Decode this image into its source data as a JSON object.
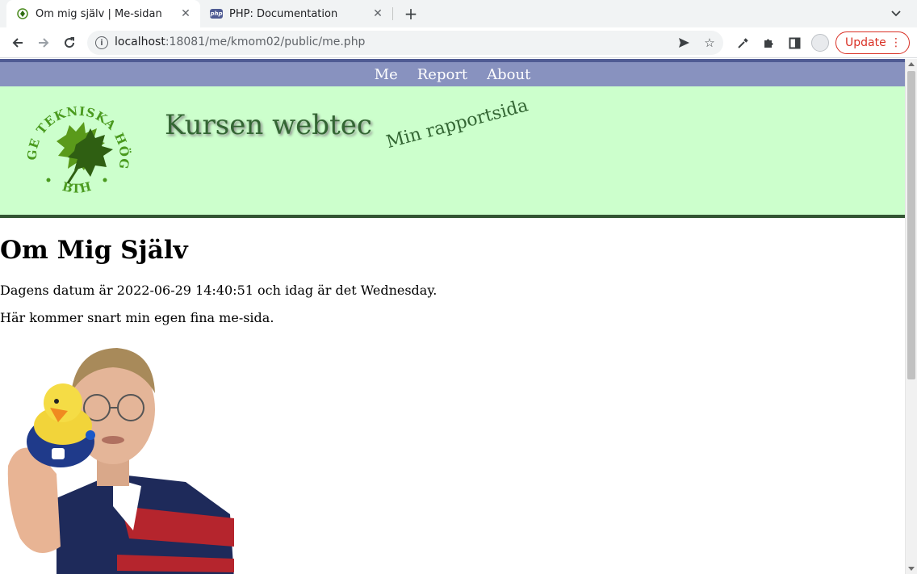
{
  "browser": {
    "tabs": [
      {
        "title": "Om mig själv | Me-sidan",
        "favicon": "bth-leaf-favicon",
        "active": true
      },
      {
        "title": "PHP: Documentation",
        "favicon": "php-favicon",
        "favicon_text": "php",
        "active": false
      }
    ],
    "url_host": "localhost",
    "url_rest": ":18081/me/kmom02/public/me.php",
    "update_label": "Update",
    "accent": "#d93025"
  },
  "site": {
    "nav": [
      "Me",
      "Report",
      "About"
    ],
    "logo_text_top": "BLEKINGE TEKNISKA HÖGSKOLA",
    "logo_text_bottom": "BTH",
    "title": "Kursen webtec",
    "slogan": "Min rapportsida",
    "colors": {
      "nav_bg": "#8892bf",
      "header_bg": "#ccffcc",
      "title": "#336633"
    }
  },
  "content": {
    "heading": "Om Mig Själv",
    "date_text": "Dagens datum är 2022-06-29 14:40:51 och idag är det Wednesday.",
    "intro_text": "Här kommer snart min egen fina me-sida."
  }
}
